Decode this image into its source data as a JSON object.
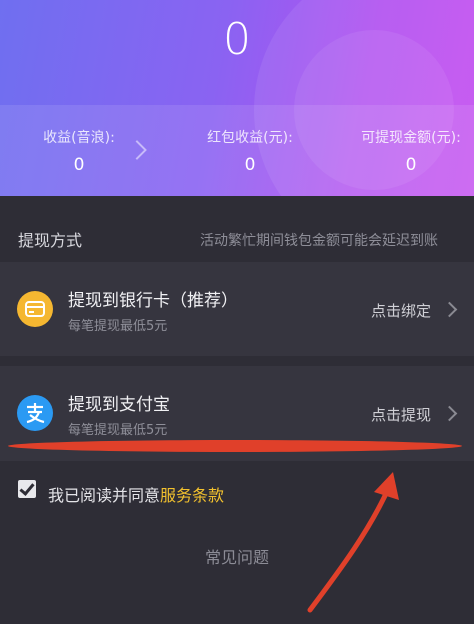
{
  "header": {
    "total": "0",
    "stats": [
      {
        "label": "收益(音浪):",
        "value": "0"
      },
      {
        "label": "红包收益(元):",
        "value": "0"
      },
      {
        "label": "可提现金额(元):",
        "value": "0"
      }
    ]
  },
  "section": {
    "title": "提现方式",
    "note": "活动繁忙期间钱包金额可能会延迟到账"
  },
  "methods": [
    {
      "title": "提现到银行卡（推荐）",
      "subtitle": "每笔提现最低5元",
      "action": "点击绑定",
      "icon": "bank-card-icon",
      "icon_color": "#f5b731"
    },
    {
      "title": "提现到支付宝",
      "subtitle": "每笔提现最低5元",
      "action": "点击提现",
      "icon": "alipay-icon",
      "icon_color": "#2b9af3"
    }
  ],
  "agreement": {
    "text": "我已阅读并同意",
    "link": "服务条款",
    "checked": true
  },
  "faq": "常见问题",
  "colors": {
    "header_gradient_start": "#6f6ff0",
    "header_gradient_end": "#c54ff0",
    "background": "#2e2d36",
    "card": "#36353f",
    "link": "#f2c12e",
    "annotation": "#e0402a"
  }
}
